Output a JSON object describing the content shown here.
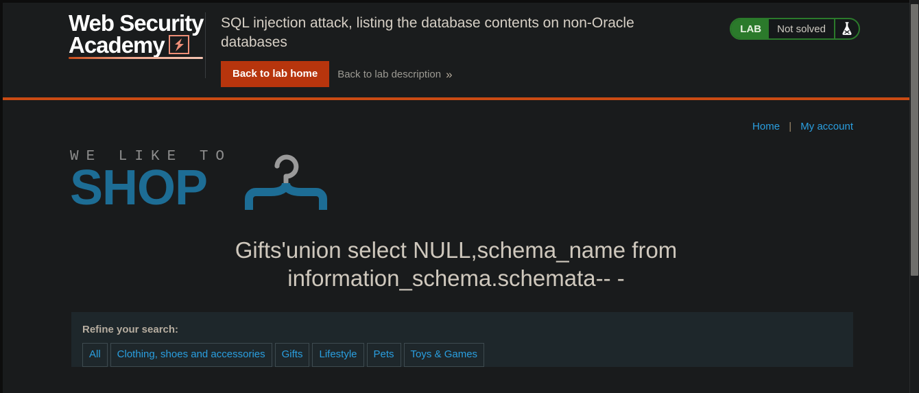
{
  "lab_header": {
    "brand": {
      "line1": "Web Security",
      "line2": "Academy",
      "bolt_icon": "lightning-bolt-icon"
    },
    "title": "SQL injection attack, listing the database contents on non-Oracle databases",
    "back_home_label": "Back to lab home",
    "back_description_label": "Back to lab description",
    "back_description_chevron": "»",
    "status": {
      "tag": "LAB",
      "text": "Not solved",
      "icon": "flask-icon",
      "accent_color": "#2b7a2b"
    },
    "accent_rule_color": "#cb4b13"
  },
  "shop": {
    "nav": {
      "home": "Home",
      "separator": "|",
      "my_account": "My account"
    },
    "logo": {
      "tagline": "WE LIKE TO",
      "word": "SHOP",
      "icon": "clothes-hanger-icon",
      "word_color": "#1d6d95"
    },
    "search_heading": "Gifts'union select NULL,schema_name from information_schema.schemata-- -",
    "refine": {
      "label": "Refine your search:",
      "filters": [
        {
          "label": "All"
        },
        {
          "label": "Clothing, shoes and accessories"
        },
        {
          "label": "Gifts"
        },
        {
          "label": "Lifestyle"
        },
        {
          "label": "Pets"
        },
        {
          "label": "Toys & Games"
        }
      ]
    }
  },
  "scrollbar": {
    "thumb_color": "#6f6f6c"
  }
}
